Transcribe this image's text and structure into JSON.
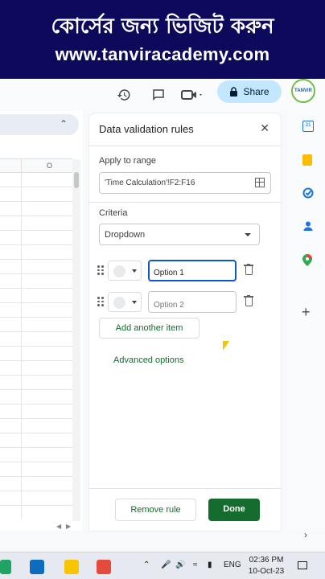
{
  "banner": {
    "line1": "কোর্সের জন্য ভিজিট করুন",
    "line2": "www.tanviracademy.com"
  },
  "toolbar": {
    "share_label": "Share",
    "avatar_text": "TANVIR"
  },
  "sheet": {
    "column_letter": "O"
  },
  "panel": {
    "title": "Data validation rules",
    "apply_label": "Apply to range",
    "range_value": "'Time Calculation'!F2:F16",
    "criteria_label": "Criteria",
    "criteria_value": "Dropdown",
    "options": [
      {
        "value": "Option 1",
        "focused": true
      },
      {
        "value": "Option 2",
        "focused": false
      }
    ],
    "add_item_label": "Add another item",
    "advanced_label": "Advanced options",
    "remove_label": "Remove rule",
    "done_label": "Done"
  },
  "rail": {
    "calendar_day": "31"
  },
  "taskbar": {
    "language": "ENG",
    "time": "02:36 PM",
    "date": "10-Oct-23"
  },
  "colors": {
    "banner_bg": "#0d0a5c",
    "share_bg": "#c2e7ff",
    "accent_green": "#146c2e",
    "focus_blue": "#0b57d0"
  }
}
